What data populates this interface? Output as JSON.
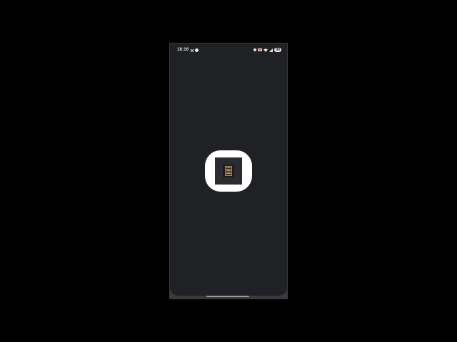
{
  "status_bar": {
    "time": "18:16",
    "battery": "90",
    "left_icons": [
      "close-notification-icon",
      "circle-notification-icon"
    ],
    "right_icons": [
      "dot-icon",
      "chat-icon",
      "wifi-icon",
      "signal-icon",
      "battery-icon"
    ]
  },
  "splash": {
    "app_icon": "book-app-icon",
    "icon_background": "#ffffff",
    "icon_inner": "#2b2c30",
    "screen_background": "#202124"
  }
}
